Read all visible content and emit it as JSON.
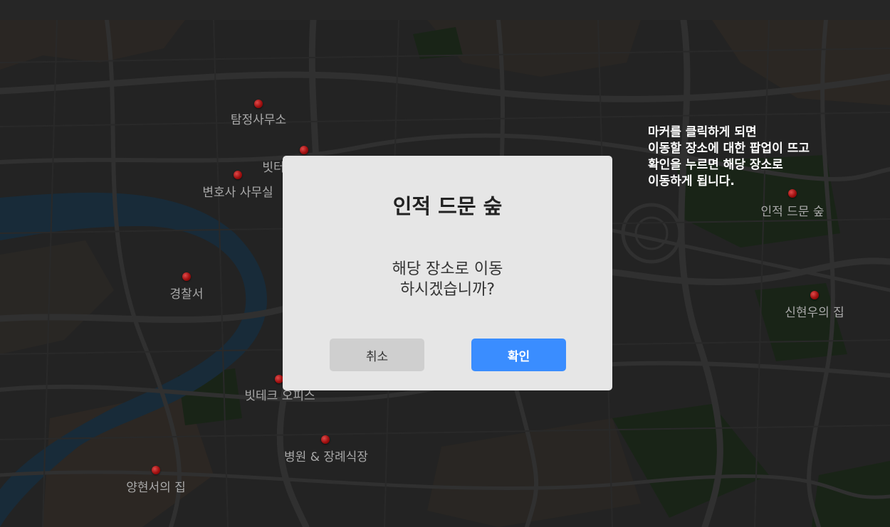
{
  "map": {
    "places": [
      {
        "name": "탐정사무소"
      },
      {
        "name": "빗터"
      },
      {
        "name": "변호사 사무실"
      },
      {
        "name": "경찰서"
      },
      {
        "name": "빗테크 오피스"
      },
      {
        "name": "병원 & 장례식장"
      },
      {
        "name": "양현서의 집"
      },
      {
        "name": "인적 드문 숲"
      },
      {
        "name": "신현우의 집"
      }
    ]
  },
  "instructions": {
    "lines": [
      "마커를 클릭하게 되면",
      "이동할 장소에 대한 팝업이 뜨고",
      "확인을 누르면 해당 장소로",
      "이동하게 됩니다."
    ]
  },
  "dialog": {
    "title": "인적 드문 숲",
    "message_line1": "해당 장소로 이동",
    "message_line2": "하시겠습니까?",
    "cancel_label": "취소",
    "confirm_label": "확인"
  },
  "colors": {
    "confirm_button": "#3a8dff",
    "cancel_button": "#cfcfcf",
    "marker": "#b01515",
    "river": "#1f3a4f",
    "park": "#1f2e1f"
  }
}
